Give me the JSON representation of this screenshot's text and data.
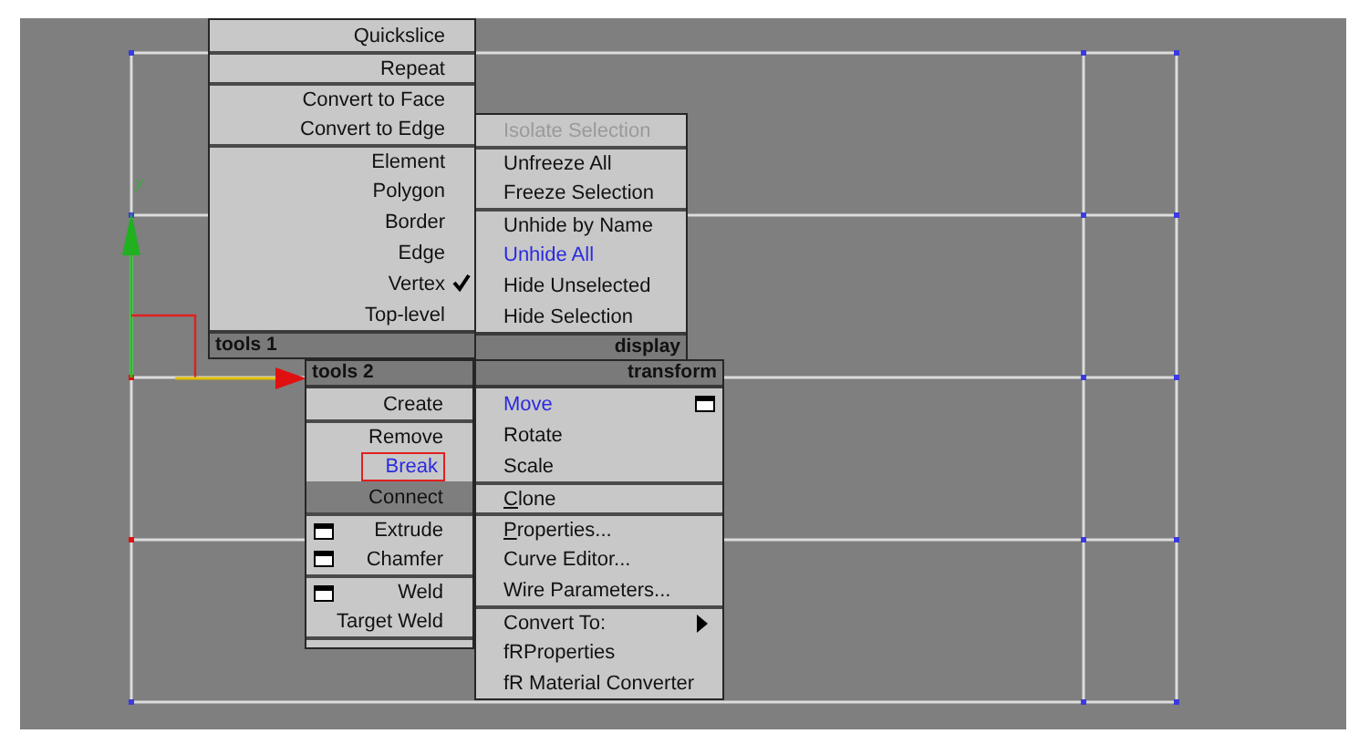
{
  "gizmo": {
    "axis_label": "y"
  },
  "menus": [
    {
      "title": "tools 1",
      "align_right": true,
      "header_bottom": true,
      "items": [
        {
          "label": "Quickslice"
        },
        {
          "label": "Repeat",
          "separator_before": true
        },
        {
          "label": "Convert to Face",
          "separator_before": true
        },
        {
          "label": "Convert to Edge"
        },
        {
          "label": "Element",
          "separator_before": true
        },
        {
          "label": "Polygon"
        },
        {
          "label": "Border"
        },
        {
          "label": "Edge"
        },
        {
          "label": "Vertex",
          "checked": true
        },
        {
          "label": "Top-level"
        }
      ]
    },
    {
      "title": "display",
      "align_right": false,
      "header_bottom": true,
      "items": [
        {
          "label": "Isolate Selection",
          "disabled": true
        },
        {
          "label": "Unfreeze All",
          "separator_before": true
        },
        {
          "label": "Freeze Selection"
        },
        {
          "label": "Unhide by Name",
          "separator_before": true
        },
        {
          "label": "Unhide All",
          "highlighted": true
        },
        {
          "label": "Hide Unselected"
        },
        {
          "label": "Hide Selection"
        }
      ]
    },
    {
      "title": "tools 2",
      "align_right": true,
      "header_bottom": false,
      "items": [
        {
          "label": "Create"
        },
        {
          "label": "Remove",
          "separator_before": true
        },
        {
          "label": "Break",
          "highlighted": true,
          "outlined": true
        },
        {
          "label": "Connect",
          "hovered": true
        },
        {
          "label": "Extrude",
          "separator_before": true,
          "option_box": true
        },
        {
          "label": "Chamfer",
          "option_box": true
        },
        {
          "label": "Weld",
          "separator_before": true,
          "option_box": true
        },
        {
          "label": "Target Weld"
        }
      ]
    },
    {
      "title": "transform",
      "align_right": false,
      "header_bottom": false,
      "items": [
        {
          "label": "Move",
          "highlighted": true,
          "option_box": true
        },
        {
          "label": "Rotate"
        },
        {
          "label": "Scale"
        },
        {
          "label": "Clone",
          "separator_before": true,
          "underline_first": true
        },
        {
          "label": "Properties...",
          "separator_before": true,
          "underline_first": true
        },
        {
          "label": "Curve Editor..."
        },
        {
          "label": "Wire Parameters..."
        },
        {
          "label": "Convert To:",
          "separator_before": true,
          "submenu": true
        },
        {
          "label": "fRProperties"
        },
        {
          "label": "fR Material Converter"
        }
      ]
    }
  ]
}
